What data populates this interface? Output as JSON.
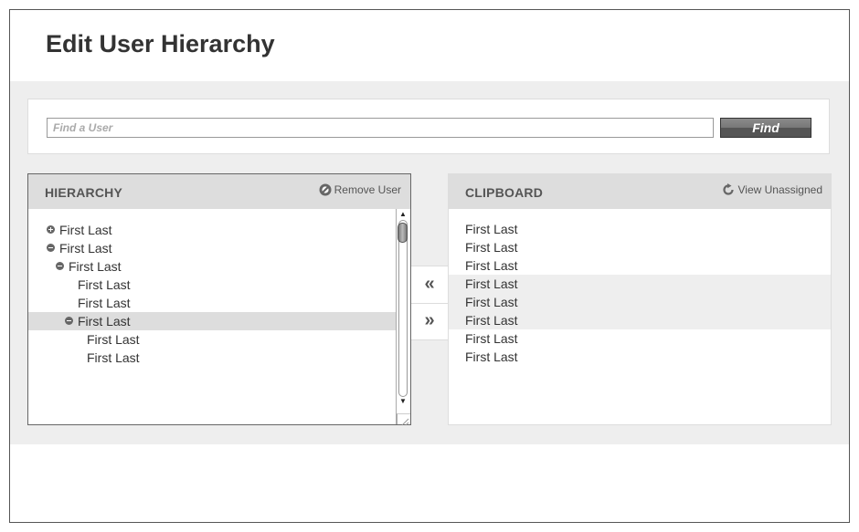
{
  "page": {
    "title": "Edit User Hierarchy"
  },
  "search": {
    "placeholder": "Find a User",
    "value": "",
    "button_label": "Find"
  },
  "hierarchy": {
    "title": "HIERARCHY",
    "action_label": "Remove User",
    "action_icon": "no-entry-icon",
    "rows": [
      {
        "label": "First Last",
        "toggle": "expand",
        "selected": false
      },
      {
        "label": "First Last",
        "toggle": "collapse",
        "selected": false
      },
      {
        "label": "First Last",
        "toggle": "collapse",
        "selected": false
      },
      {
        "label": "First Last",
        "toggle": null,
        "selected": false
      },
      {
        "label": "First Last",
        "toggle": null,
        "selected": false
      },
      {
        "label": "First Last",
        "toggle": "collapse",
        "selected": true
      },
      {
        "label": "First Last",
        "toggle": null,
        "selected": false
      },
      {
        "label": "First Last",
        "toggle": null,
        "selected": false
      }
    ]
  },
  "move": {
    "left_label": "«",
    "right_label": "»"
  },
  "clipboard": {
    "title": "CLIPBOARD",
    "action_label": "View Unassigned",
    "action_icon": "refresh-icon",
    "rows": [
      {
        "label": "First Last",
        "highlighted": false
      },
      {
        "label": "First Last",
        "highlighted": false
      },
      {
        "label": "First Last",
        "highlighted": false
      },
      {
        "label": "First Last",
        "highlighted": true
      },
      {
        "label": "First Last",
        "highlighted": true
      },
      {
        "label": "First Last",
        "highlighted": true
      },
      {
        "label": "First Last",
        "highlighted": false
      },
      {
        "label": "First Last",
        "highlighted": false
      }
    ]
  },
  "colors": {
    "band": "#eeeeee",
    "header": "#dddddd",
    "selected_row": "#dddddd",
    "text": "#333333"
  }
}
